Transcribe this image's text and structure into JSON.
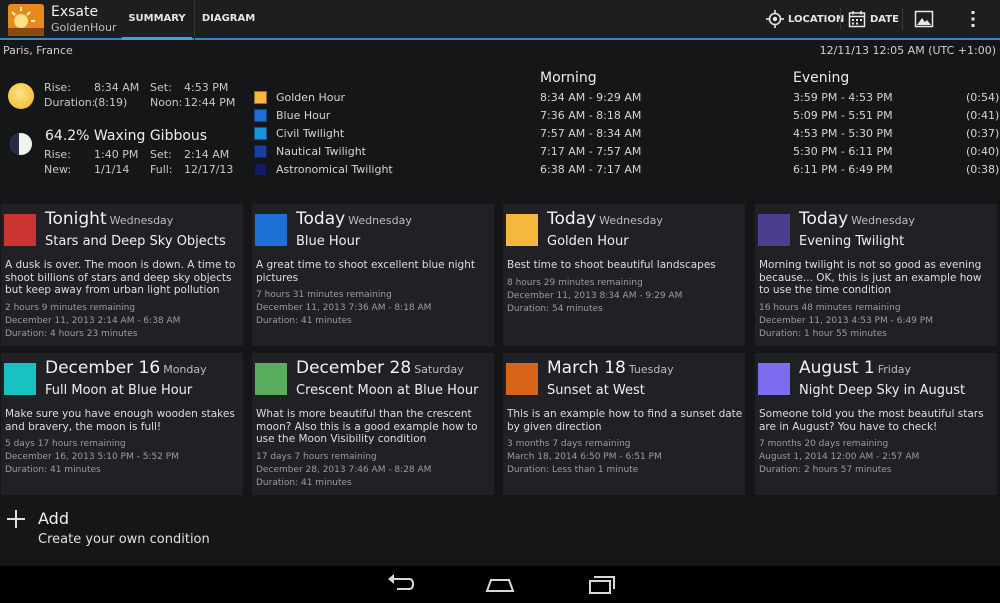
{
  "app": {
    "title": "Exsate",
    "subtitle": "GoldenHour",
    "tabs": [
      {
        "label": "SUMMARY",
        "selected": true
      },
      {
        "label": "DIAGRAM",
        "selected": false
      }
    ],
    "actions": {
      "location": "LOCATION",
      "date": "DATE"
    },
    "accent_color": "#33a9dc"
  },
  "info": {
    "place": "Paris, France",
    "datetime": "12/11/13 12:05 AM (UTC +1:00)"
  },
  "sun": {
    "rise_label": "Rise:",
    "rise": "8:34 AM",
    "set_label": "Set:",
    "set": "4:53 PM",
    "duration_label": "Duration:",
    "duration": "(8:19)",
    "noon_label": "Noon:",
    "noon": "12:44 PM"
  },
  "moon": {
    "phase": "64.2% Waxing Gibbous",
    "rise_label": "Rise:",
    "rise": "1:40 PM",
    "set_label": "Set:",
    "set": "2:14 AM",
    "new_label": "New:",
    "new": "1/1/14",
    "full_label": "Full:",
    "full": "12/17/13"
  },
  "legend": [
    {
      "label": "Golden Hour",
      "color": "#f5b83d"
    },
    {
      "label": "Blue Hour",
      "color": "#1e6fd6"
    },
    {
      "label": "Civil Twilight",
      "color": "#1794e0"
    },
    {
      "label": "Nautical Twilight",
      "color": "#1b3f9e"
    },
    {
      "label": "Astronomical Twilight",
      "color": "#15195e"
    }
  ],
  "times": {
    "morning_header": "Morning",
    "evening_header": "Evening",
    "rows": [
      {
        "morning": "8:34 AM - 9:29 AM",
        "evening": "3:59 PM - 4:53 PM",
        "duration": "(0:54)"
      },
      {
        "morning": "7:36 AM - 8:18 AM",
        "evening": "5:09 PM - 5:51 PM",
        "duration": "(0:41)"
      },
      {
        "morning": "7:57 AM - 8:34 AM",
        "evening": "4:53 PM - 5:30 PM",
        "duration": "(0:37)"
      },
      {
        "morning": "7:17 AM - 7:57 AM",
        "evening": "5:30 PM - 6:11 PM",
        "duration": "(0:40)"
      },
      {
        "morning": "6:38 AM - 7:17 AM",
        "evening": "6:11 PM - 6:49 PM",
        "duration": "(0:38)"
      }
    ]
  },
  "cards": [
    {
      "date": "Tonight",
      "day": "Wednesday",
      "title": "Stars and Deep Sky Objects",
      "color": "#cc3333",
      "description": "A dusk is over. The moon is down. A time to shoot billions of stars and deep sky objects but keep away from urban light pollution",
      "remaining": "2 hours 9 minutes remaining",
      "range": "December 11, 2013 2:14 AM - 6:38 AM",
      "duration": "Duration: 4 hours 23 minutes"
    },
    {
      "date": "Today",
      "day": "Wednesday",
      "title": "Blue Hour",
      "color": "#1e6fd6",
      "description": "A great time to shoot excellent blue night pictures",
      "remaining": "7 hours 31 minutes remaining",
      "range": "December 11, 2013 7:36 AM - 8:18 AM",
      "duration": "Duration: 41 minutes"
    },
    {
      "date": "Today",
      "day": "Wednesday",
      "title": "Golden Hour",
      "color": "#f5b83d",
      "description": "Best time to shoot beautiful landscapes",
      "remaining": "8 hours 29 minutes remaining",
      "range": "December 11, 2013 8:34 AM - 9:29 AM",
      "duration": "Duration: 54 minutes"
    },
    {
      "date": "Today",
      "day": "Wednesday",
      "title": "Evening Twilight",
      "color": "#4a3f8c",
      "description": "Morning twilight is not so good as evening because... OK, this is just an example how to use the time condition",
      "remaining": "16 hours 48 minutes remaining",
      "range": "December 11, 2013 4:53 PM - 6:49 PM",
      "duration": "Duration: 1 hour 55 minutes"
    },
    {
      "date": "December 16",
      "day": "Monday",
      "title": "Full Moon at Blue Hour",
      "color": "#18c2c2",
      "description": "Make sure you have enough wooden stakes and bravery, the moon is full!",
      "remaining": "5 days 17 hours remaining",
      "range": "December 16, 2013 5:10 PM - 5:52 PM",
      "duration": "Duration: 41 minutes"
    },
    {
      "date": "December 28",
      "day": "Saturday",
      "title": "Crescent Moon at Blue Hour",
      "color": "#5aad5e",
      "description": "What is more beautiful than the crescent moon? Also this is a good example how to use the Moon Visibility condition",
      "remaining": "17 days 7 hours remaining",
      "range": "December 28, 2013 7:46 AM - 8:28 AM",
      "duration": "Duration: 41 minutes"
    },
    {
      "date": "March 18",
      "day": "Tuesday",
      "title": "Sunset at West",
      "color": "#d9631a",
      "description": "This is an example how to find a sunset date by given direction",
      "remaining": "3 months 7 days remaining",
      "range": "March 18, 2014 6:50 PM - 6:51 PM",
      "duration": "Duration: Less than 1 minute"
    },
    {
      "date": "August 1",
      "day": "Friday",
      "title": "Night Deep Sky in August",
      "color": "#7c6cf0",
      "description": "Someone told you the most beautiful stars are in August? You have to check!",
      "remaining": "7 months 20 days remaining",
      "range": "August 1, 2014 12:00 AM - 2:57 AM",
      "duration": "Duration: 2 hours 57 minutes"
    }
  ],
  "add": {
    "title": "Add",
    "subtitle": "Create your own condition"
  },
  "navbar": {
    "icons": [
      "back-icon",
      "home-icon",
      "recent-apps-icon"
    ]
  }
}
